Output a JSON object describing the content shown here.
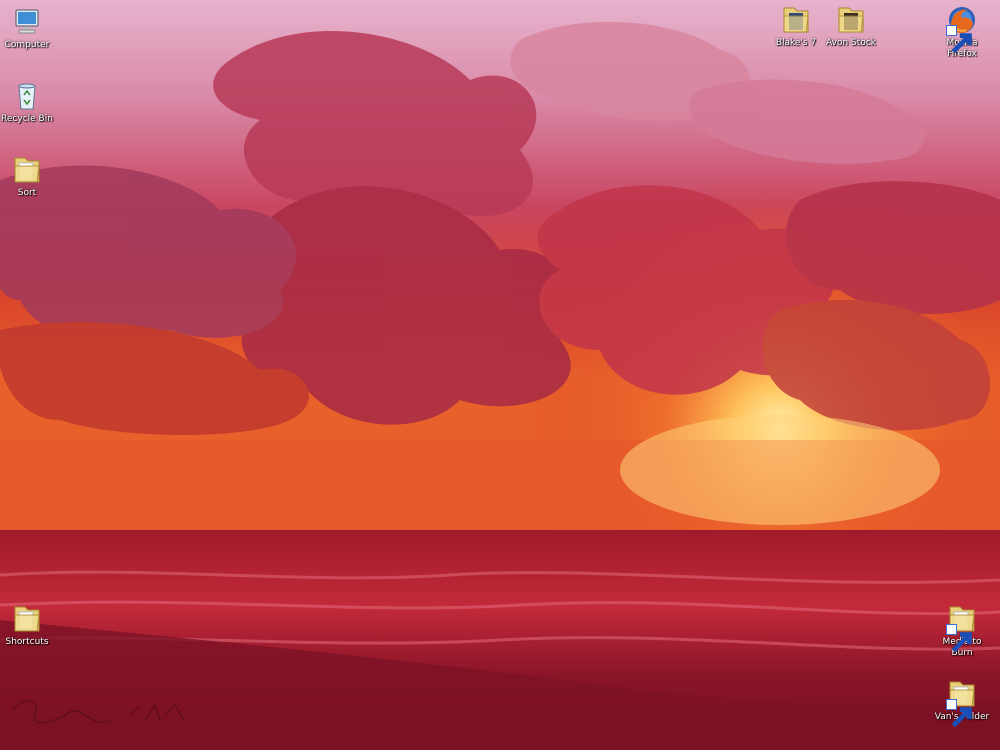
{
  "desktop": {
    "icons_left": [
      {
        "label": "Computer"
      },
      {
        "label": "Recycle Bin"
      },
      {
        "label": "Sort"
      },
      {
        "label": "Shortcuts"
      }
    ],
    "icons_top": [
      {
        "label": "Blake's 7"
      },
      {
        "label": "Avon Stock"
      },
      {
        "label": "Mozilla Firefox"
      }
    ],
    "icons_right": [
      {
        "label": "Media to Burn"
      },
      {
        "label": "Van's Folder"
      }
    ],
    "wallpaper": {
      "description_colors": [
        "#f2c6d8",
        "#c8405a",
        "#e8602a",
        "#ffd27a",
        "#8c1528"
      ]
    }
  }
}
